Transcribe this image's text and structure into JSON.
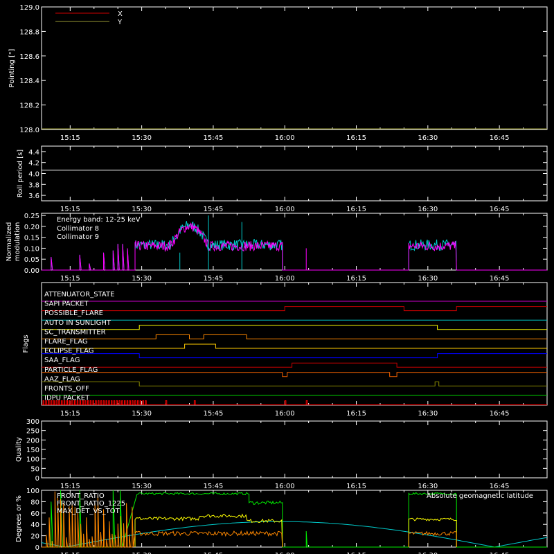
{
  "x_ticks": [
    "15:15",
    "15:30",
    "15:45",
    "16:00",
    "16:15",
    "16:30",
    "16:45"
  ],
  "chart_data": [
    {
      "type": "line",
      "ylabel": "Pointing [\"]",
      "ylim": [
        128.0,
        129.0
      ],
      "yticks": [
        "128.0",
        "128.2",
        "128.4",
        "128.6",
        "128.8",
        "129.0"
      ],
      "legend": [
        {
          "name": "X",
          "color": "#cc0000"
        },
        {
          "name": "Y",
          "color": "#999933"
        }
      ],
      "series": [
        {
          "name": "Y",
          "color": "#999933",
          "values": "flat at 128.0"
        }
      ]
    },
    {
      "type": "line",
      "ylabel": "Roll period [s]",
      "ylim": [
        3.5,
        4.5
      ],
      "yticks": [
        "3.6",
        "3.8",
        "4.0",
        "4.2",
        "4.4"
      ],
      "value": 4.06
    },
    {
      "type": "line",
      "ylabel": "Normalized modulation",
      "ylim": [
        0.0,
        0.26
      ],
      "yticks": [
        "0.00",
        "0.05",
        "0.10",
        "0.15",
        "0.20",
        "0.25"
      ],
      "annotation": "Energy band: 12-25 keV",
      "legend": [
        {
          "name": "Collimator 8",
          "color": "#00cccc"
        },
        {
          "name": "Collimator 9",
          "color": "#ff00ff"
        }
      ]
    },
    {
      "type": "line",
      "ylabel": "Flags",
      "flags": [
        {
          "name": "ATTENUATOR_STATE",
          "color": "#cc00cc"
        },
        {
          "name": "SAPI PACKET",
          "color": "#cc0000"
        },
        {
          "name": "POSSIBLE_FLARE",
          "color": "#00cccc"
        },
        {
          "name": "AUTO IN SUNLIGHT",
          "color": "#ffff00"
        },
        {
          "name": "SC_TRANSMITTER",
          "color": "#ff8800"
        },
        {
          "name": "FLARE_FLAG",
          "color": "#ffcc00"
        },
        {
          "name": "ECLIPSE_FLAG",
          "color": "#0000ff"
        },
        {
          "name": "SAA_FLAG",
          "color": "#cc0000"
        },
        {
          "name": "PARTICLE_FLAG",
          "color": "#ff6600"
        },
        {
          "name": "AAZ_FLAG",
          "color": "#888800"
        },
        {
          "name": "FRONTS_OFF",
          "color": "#00cc00"
        },
        {
          "name": "IDPU PACKET",
          "color": "#ff0000"
        }
      ]
    },
    {
      "type": "line",
      "ylabel": "Quality",
      "ylim": [
        0,
        300
      ],
      "yticks": [
        "0",
        "50",
        "100",
        "150",
        "200",
        "250",
        "300"
      ]
    },
    {
      "type": "line",
      "ylabel": "Degrees or %",
      "ylim": [
        0,
        100
      ],
      "yticks": [
        "0",
        "20",
        "40",
        "60",
        "80",
        "100"
      ],
      "legend": [
        {
          "name": "FRONT_RATIO",
          "color": "#ffff00"
        },
        {
          "name": "FRONT_RATIO_1225",
          "color": "#00ee00"
        },
        {
          "name": "MAX_DET_VS_TOT",
          "color": "#ff8800"
        }
      ],
      "annotation": "Absolute geomagnetic latitude",
      "annotation_color": "#00cccc"
    }
  ]
}
